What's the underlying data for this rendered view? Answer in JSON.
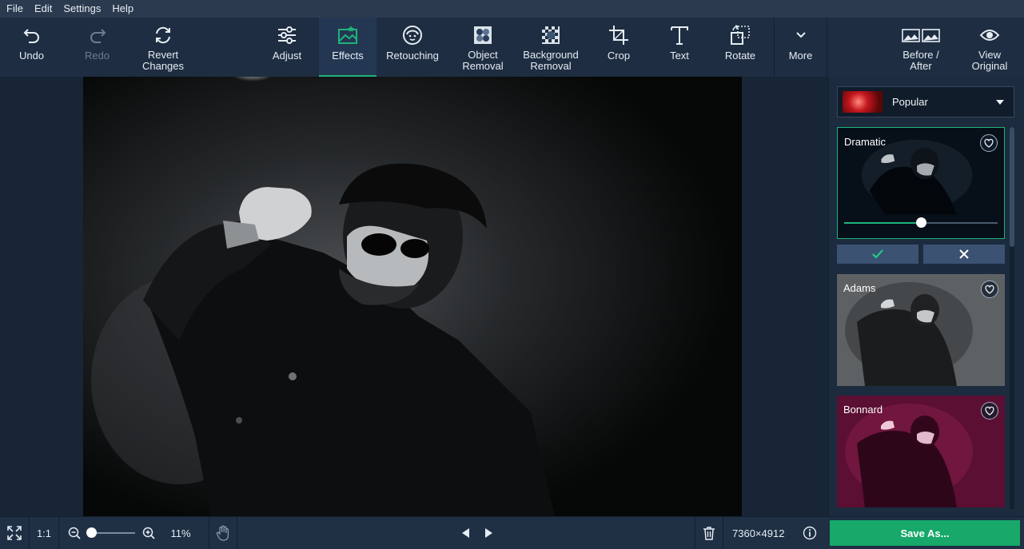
{
  "menu": [
    "File",
    "Edit",
    "Settings",
    "Help"
  ],
  "toolbar": {
    "undo": "Undo",
    "redo": "Redo",
    "revert": "Revert\nChanges",
    "adjust": "Adjust",
    "effects": "Effects",
    "retouching": "Retouching",
    "object_removal": "Object\nRemoval",
    "background_removal": "Background\nRemoval",
    "crop": "Crop",
    "text": "Text",
    "rotate": "Rotate",
    "more": "More",
    "before_after": "Before /\nAfter",
    "view_original": "View\nOriginal"
  },
  "panel": {
    "collection": "Popular",
    "effects": [
      {
        "name": "Dramatic",
        "strength": 0.5,
        "selected": true
      },
      {
        "name": "Adams"
      },
      {
        "name": "Bonnard"
      }
    ]
  },
  "status": {
    "fit_label": "1:1",
    "zoom": "11%",
    "dimensions": "7360×4912",
    "save": "Save As..."
  },
  "colors": {
    "accent": "#1fb37a",
    "save": "#17a86a",
    "toolbar_bg": "#1e2d41",
    "menubar_bg": "#2b3a4e"
  },
  "icons": {
    "undo": "undo-icon",
    "redo": "redo-icon",
    "revert": "revert-icon",
    "adjust": "sliders-icon",
    "effects": "effects-icon",
    "retouching": "face-icon",
    "object_removal": "object-removal-icon",
    "background_removal": "background-removal-icon",
    "crop": "crop-icon",
    "text": "text-icon",
    "rotate": "rotate-icon",
    "more": "chevron-down-icon",
    "before_after": "before-after-icon",
    "view_original": "eye-icon"
  }
}
